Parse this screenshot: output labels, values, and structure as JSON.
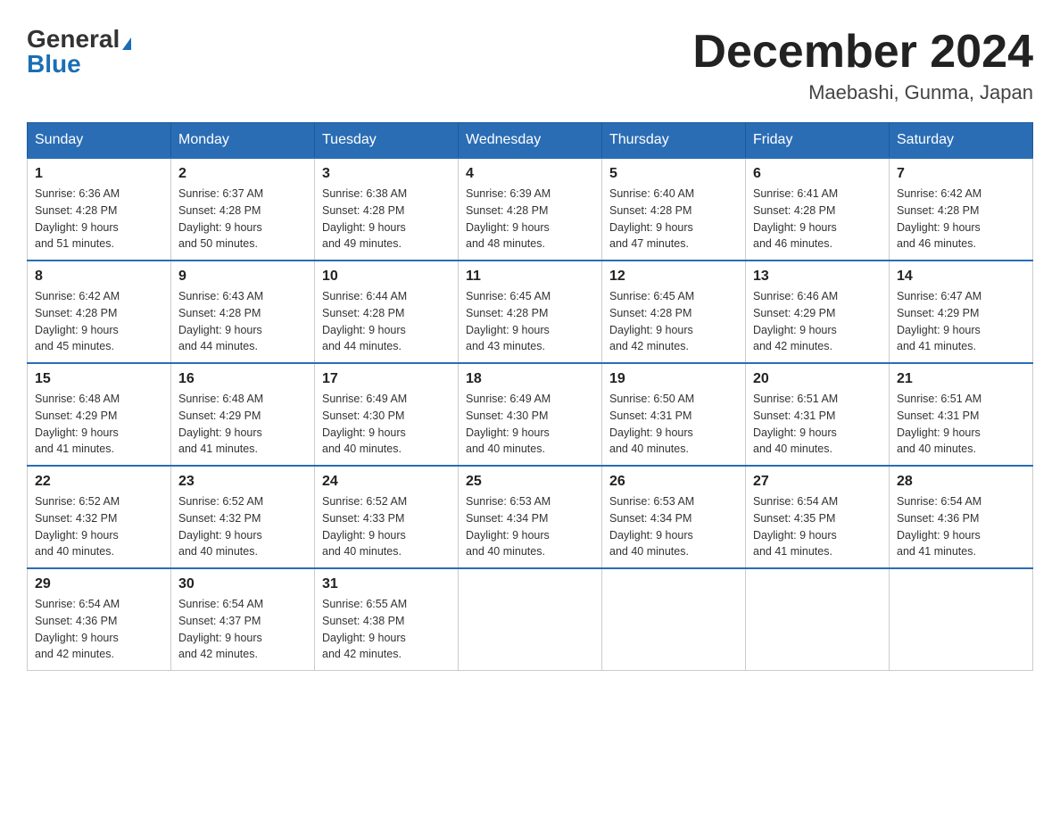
{
  "header": {
    "logo_general": "General",
    "logo_blue": "Blue",
    "title": "December 2024",
    "location": "Maebashi, Gunma, Japan"
  },
  "weekdays": [
    "Sunday",
    "Monday",
    "Tuesday",
    "Wednesday",
    "Thursday",
    "Friday",
    "Saturday"
  ],
  "weeks": [
    [
      {
        "day": "1",
        "sunrise": "6:36 AM",
        "sunset": "4:28 PM",
        "daylight": "9 hours and 51 minutes."
      },
      {
        "day": "2",
        "sunrise": "6:37 AM",
        "sunset": "4:28 PM",
        "daylight": "9 hours and 50 minutes."
      },
      {
        "day": "3",
        "sunrise": "6:38 AM",
        "sunset": "4:28 PM",
        "daylight": "9 hours and 49 minutes."
      },
      {
        "day": "4",
        "sunrise": "6:39 AM",
        "sunset": "4:28 PM",
        "daylight": "9 hours and 48 minutes."
      },
      {
        "day": "5",
        "sunrise": "6:40 AM",
        "sunset": "4:28 PM",
        "daylight": "9 hours and 47 minutes."
      },
      {
        "day": "6",
        "sunrise": "6:41 AM",
        "sunset": "4:28 PM",
        "daylight": "9 hours and 46 minutes."
      },
      {
        "day": "7",
        "sunrise": "6:42 AM",
        "sunset": "4:28 PM",
        "daylight": "9 hours and 46 minutes."
      }
    ],
    [
      {
        "day": "8",
        "sunrise": "6:42 AM",
        "sunset": "4:28 PM",
        "daylight": "9 hours and 45 minutes."
      },
      {
        "day": "9",
        "sunrise": "6:43 AM",
        "sunset": "4:28 PM",
        "daylight": "9 hours and 44 minutes."
      },
      {
        "day": "10",
        "sunrise": "6:44 AM",
        "sunset": "4:28 PM",
        "daylight": "9 hours and 44 minutes."
      },
      {
        "day": "11",
        "sunrise": "6:45 AM",
        "sunset": "4:28 PM",
        "daylight": "9 hours and 43 minutes."
      },
      {
        "day": "12",
        "sunrise": "6:45 AM",
        "sunset": "4:28 PM",
        "daylight": "9 hours and 42 minutes."
      },
      {
        "day": "13",
        "sunrise": "6:46 AM",
        "sunset": "4:29 PM",
        "daylight": "9 hours and 42 minutes."
      },
      {
        "day": "14",
        "sunrise": "6:47 AM",
        "sunset": "4:29 PM",
        "daylight": "9 hours and 41 minutes."
      }
    ],
    [
      {
        "day": "15",
        "sunrise": "6:48 AM",
        "sunset": "4:29 PM",
        "daylight": "9 hours and 41 minutes."
      },
      {
        "day": "16",
        "sunrise": "6:48 AM",
        "sunset": "4:29 PM",
        "daylight": "9 hours and 41 minutes."
      },
      {
        "day": "17",
        "sunrise": "6:49 AM",
        "sunset": "4:30 PM",
        "daylight": "9 hours and 40 minutes."
      },
      {
        "day": "18",
        "sunrise": "6:49 AM",
        "sunset": "4:30 PM",
        "daylight": "9 hours and 40 minutes."
      },
      {
        "day": "19",
        "sunrise": "6:50 AM",
        "sunset": "4:31 PM",
        "daylight": "9 hours and 40 minutes."
      },
      {
        "day": "20",
        "sunrise": "6:51 AM",
        "sunset": "4:31 PM",
        "daylight": "9 hours and 40 minutes."
      },
      {
        "day": "21",
        "sunrise": "6:51 AM",
        "sunset": "4:31 PM",
        "daylight": "9 hours and 40 minutes."
      }
    ],
    [
      {
        "day": "22",
        "sunrise": "6:52 AM",
        "sunset": "4:32 PM",
        "daylight": "9 hours and 40 minutes."
      },
      {
        "day": "23",
        "sunrise": "6:52 AM",
        "sunset": "4:32 PM",
        "daylight": "9 hours and 40 minutes."
      },
      {
        "day": "24",
        "sunrise": "6:52 AM",
        "sunset": "4:33 PM",
        "daylight": "9 hours and 40 minutes."
      },
      {
        "day": "25",
        "sunrise": "6:53 AM",
        "sunset": "4:34 PM",
        "daylight": "9 hours and 40 minutes."
      },
      {
        "day": "26",
        "sunrise": "6:53 AM",
        "sunset": "4:34 PM",
        "daylight": "9 hours and 40 minutes."
      },
      {
        "day": "27",
        "sunrise": "6:54 AM",
        "sunset": "4:35 PM",
        "daylight": "9 hours and 41 minutes."
      },
      {
        "day": "28",
        "sunrise": "6:54 AM",
        "sunset": "4:36 PM",
        "daylight": "9 hours and 41 minutes."
      }
    ],
    [
      {
        "day": "29",
        "sunrise": "6:54 AM",
        "sunset": "4:36 PM",
        "daylight": "9 hours and 42 minutes."
      },
      {
        "day": "30",
        "sunrise": "6:54 AM",
        "sunset": "4:37 PM",
        "daylight": "9 hours and 42 minutes."
      },
      {
        "day": "31",
        "sunrise": "6:55 AM",
        "sunset": "4:38 PM",
        "daylight": "9 hours and 42 minutes."
      },
      null,
      null,
      null,
      null
    ]
  ],
  "labels": {
    "sunrise": "Sunrise:",
    "sunset": "Sunset:",
    "daylight": "Daylight:"
  }
}
